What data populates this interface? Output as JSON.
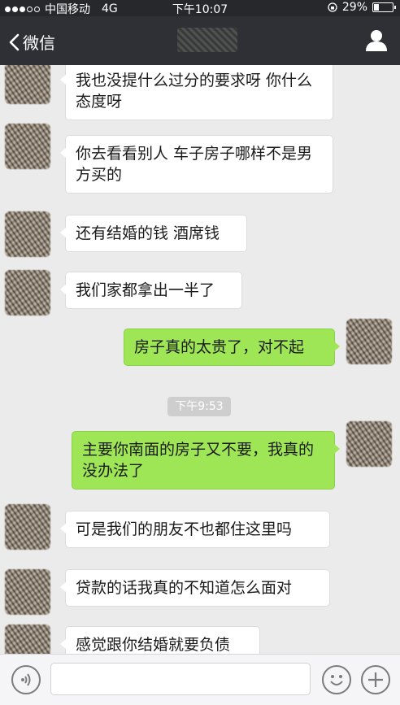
{
  "status_bar": {
    "carrier": "中国移动",
    "network": "4G",
    "time": "下午10:07",
    "battery": "29%",
    "battery_level": 0.29
  },
  "nav": {
    "back_label": "微信",
    "back_icon": "chevron-left-icon",
    "profile_icon": "person-icon"
  },
  "messages": [
    {
      "side": "in",
      "text": "我也没提什么过分的要求呀 你什么态度呀"
    },
    {
      "side": "in",
      "text": "你去看看别人 车子房子哪样不是男方买的"
    },
    {
      "side": "in",
      "text": "还有结婚的钱 酒席钱"
    },
    {
      "side": "in",
      "text": "我们家都拿出一半了"
    },
    {
      "side": "out",
      "text": "房子真的太贵了，对不起"
    },
    {
      "side": "out",
      "text": "主要你南面的房子又不要，我真的没办法了"
    },
    {
      "side": "in",
      "text": "可是我们的朋友不也都住这里吗"
    },
    {
      "side": "in",
      "text": "贷款的话我真的不知道怎么面对"
    },
    {
      "side": "in",
      "text": "感觉跟你结婚就要负债"
    }
  ],
  "timestamp": "下午9:53",
  "input_bar": {
    "voice_icon": "voice-icon",
    "emoji_icon": "emoji-icon",
    "plus_icon": "plus-icon",
    "placeholder": ""
  },
  "colors": {
    "outgoing_bubble": "#9fe657",
    "incoming_bubble": "#ffffff",
    "nav_background": "#2e3035",
    "chat_background": "#ebebeb"
  }
}
